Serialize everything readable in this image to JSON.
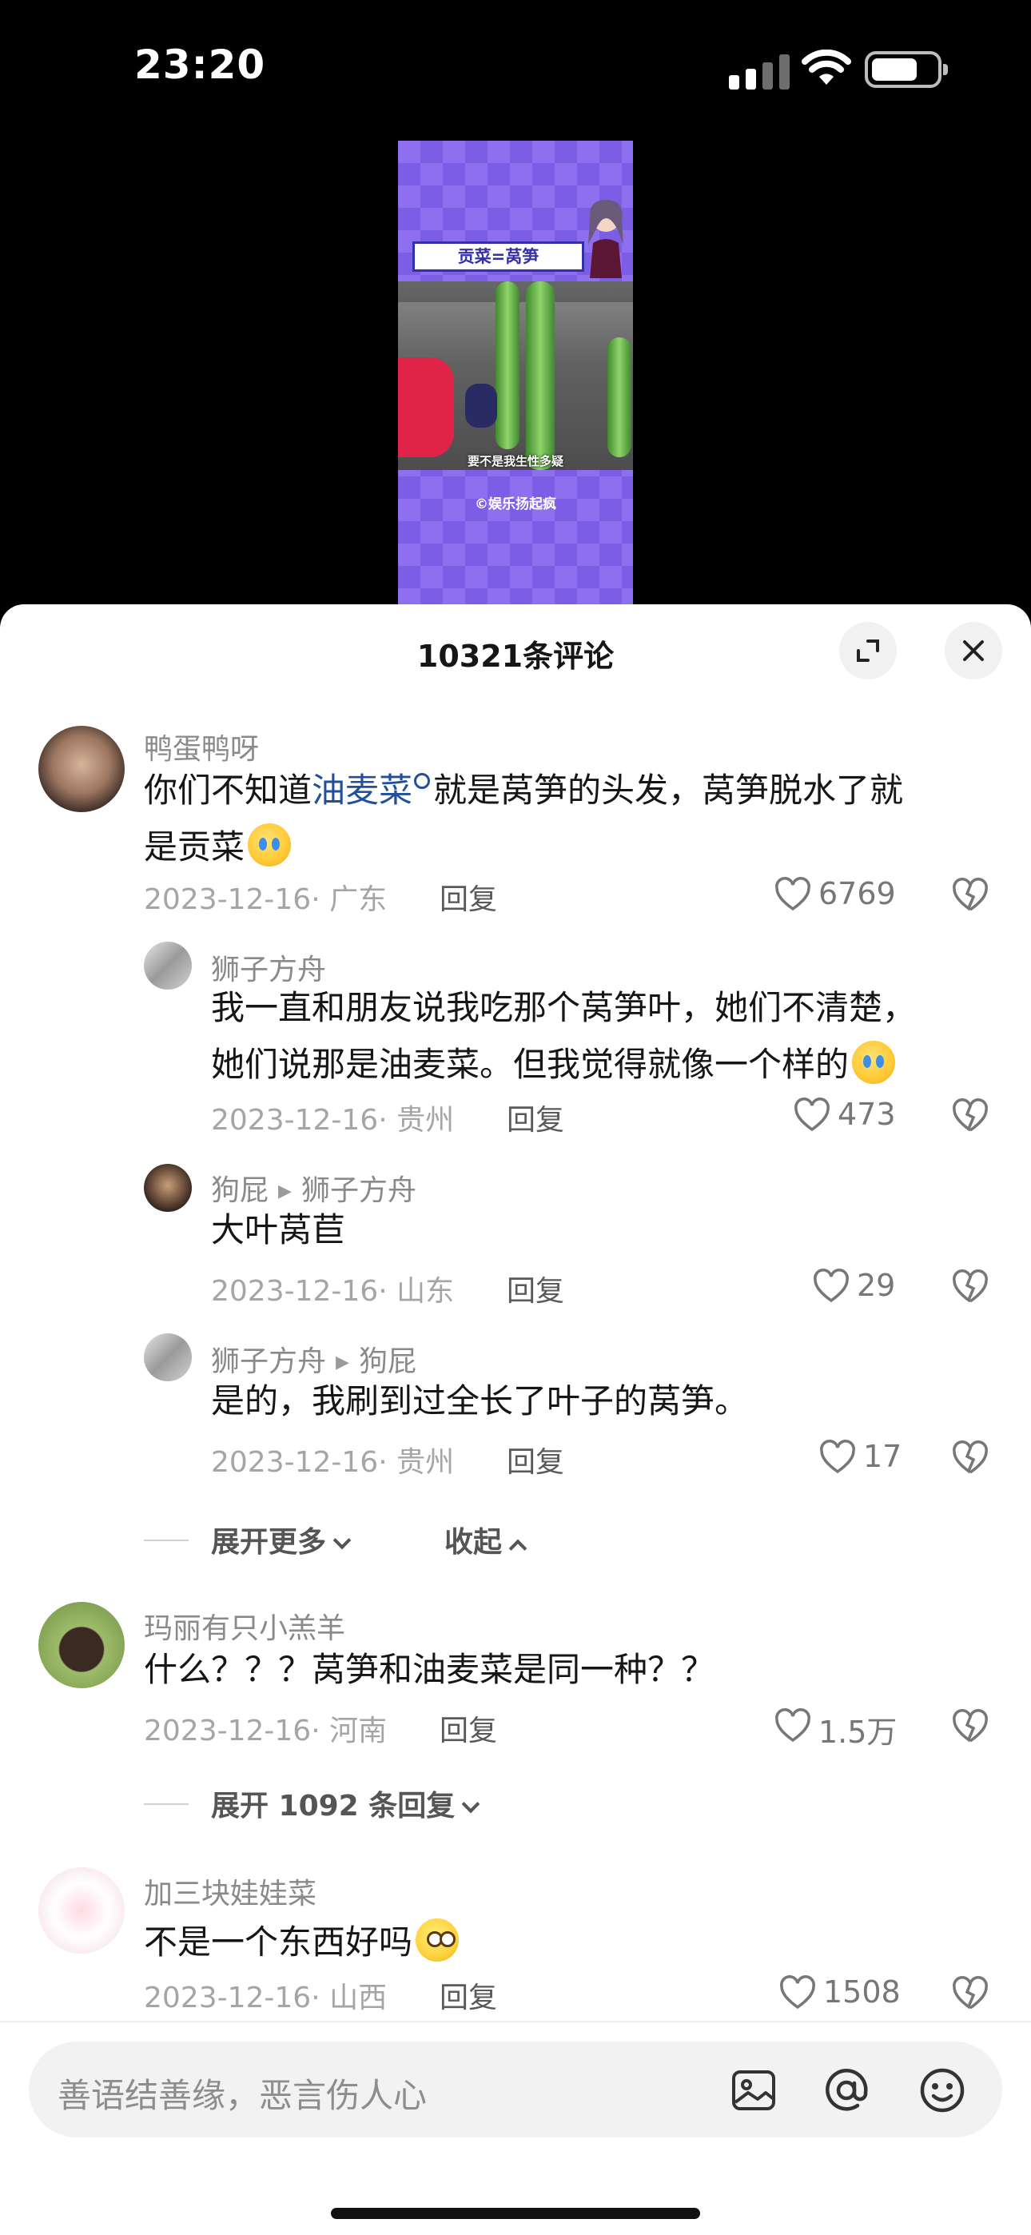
{
  "status_bar": {
    "time": "23:20"
  },
  "video": {
    "title_overlay": "贡菜=莴笋",
    "caption": "要不是我生性多疑",
    "watermark": "©娱乐扬起疯"
  },
  "sheet": {
    "title": "10321条评论"
  },
  "comments": [
    {
      "user": "鸭蛋鸭呀",
      "text_before": "你们不知道",
      "link": "油麦菜",
      "text_line1_after": "就是莴笋的头发，莴笋脱水了就",
      "text_line2": "是贡菜",
      "emoji": "cry-worried-emoji",
      "date": "2023-12-16",
      "location": "广东",
      "reply_label": "回复",
      "likes": "6769",
      "replies": [
        {
          "user": "狮子方舟",
          "reply_to": "",
          "line1": "我一直和朋友说我吃那个莴笋叶，她们不清楚，",
          "line2": "她们说那是油麦菜。但我觉得就像一个样的",
          "emoji": "crying-laughing-emoji",
          "date": "2023-12-16",
          "location": "贵州",
          "reply_label": "回复",
          "likes": "473"
        },
        {
          "user": "狗屁",
          "reply_to": "狮子方舟",
          "line1": "大叶莴苣",
          "date": "2023-12-16",
          "location": "山东",
          "reply_label": "回复",
          "likes": "29"
        },
        {
          "user": "狮子方舟",
          "reply_to": "狗屁",
          "line1": "是的，我刷到过全长了叶子的莴笋。",
          "date": "2023-12-16",
          "location": "贵州",
          "reply_label": "回复",
          "likes": "17"
        }
      ],
      "expand_more": "展开更多",
      "collapse": "收起"
    },
    {
      "user": "玛丽有只小羔羊",
      "text": "什么？？？莴笋和油麦菜是同一种？？",
      "date": "2023-12-16",
      "location": "河南",
      "reply_label": "回复",
      "likes": "1.5万",
      "expand": "展开 1092 条回复"
    },
    {
      "user": "加三块娃娃菜",
      "text": "不是一个东西好吗",
      "emoji": "flushed-emoji",
      "date": "2023-12-16",
      "location": "山西",
      "reply_label": "回复",
      "likes": "1508"
    }
  ],
  "input": {
    "placeholder": "善语结善缘，恶言伤人心",
    "icons": [
      "image-icon",
      "at-icon",
      "emoji-icon"
    ]
  },
  "colors": {
    "link": "#214f99",
    "meta": "#a5a5a5",
    "sheet_bg": "#ffffff",
    "video_purple": "#8d6ff0"
  }
}
